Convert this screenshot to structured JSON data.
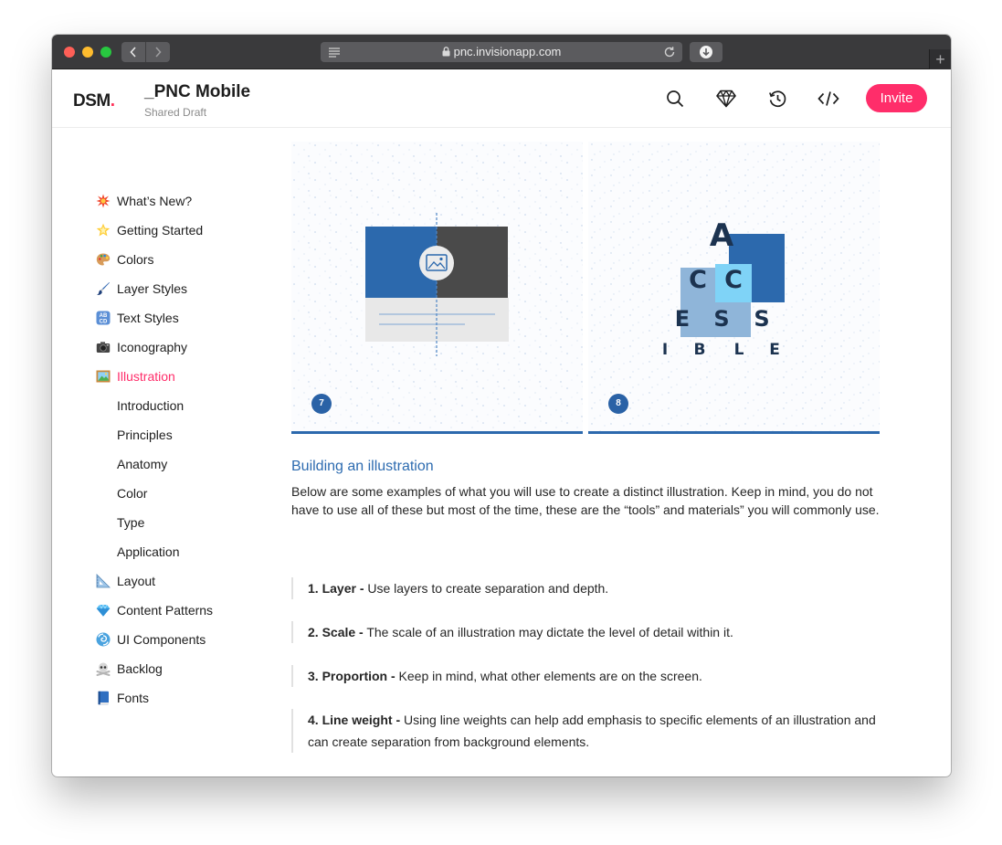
{
  "browser": {
    "url": "pnc.invisionapp.com"
  },
  "header": {
    "logo": "DSM",
    "logo_dot": ".",
    "project_title": "_PNC Mobile",
    "project_subtitle": "Shared Draft",
    "icons": [
      "search-icon",
      "sketch-diamond-icon",
      "history-icon",
      "code-icon"
    ],
    "invite_label": "Invite"
  },
  "sidebar": {
    "items": [
      {
        "icon": "collision-icon",
        "label": "What’s New?"
      },
      {
        "icon": "glowing-star-icon",
        "label": "Getting Started"
      },
      {
        "icon": "palette-icon",
        "label": "Colors"
      },
      {
        "icon": "paintbrush-icon",
        "label": "Layer Styles"
      },
      {
        "icon": "abcd-icon",
        "label": "Text Styles"
      },
      {
        "icon": "camera-icon",
        "label": "Iconography"
      },
      {
        "icon": "framed-picture-icon",
        "label": "Illustration",
        "active": true
      },
      {
        "icon": "triangular-ruler-icon",
        "label": "Layout"
      },
      {
        "icon": "gem-icon",
        "label": "Content Patterns"
      },
      {
        "icon": "cyclone-icon",
        "label": "UI Components"
      },
      {
        "icon": "skull-crossbones-icon",
        "label": "Backlog"
      },
      {
        "icon": "blue-book-icon",
        "label": "Fonts"
      }
    ],
    "subitems": [
      "Introduction",
      "Principles",
      "Anatomy",
      "Color",
      "Type",
      "Application"
    ],
    "active_color": "#ff2d6a"
  },
  "illustrations": [
    {
      "number": "7",
      "type": "image-card"
    },
    {
      "number": "8",
      "type": "accessible-letters",
      "letters": [
        "A",
        "C",
        "C",
        "E",
        "S",
        "S",
        "I",
        "B",
        "L",
        "E"
      ]
    }
  ],
  "content": {
    "title": "Building an illustration",
    "intro": "Below are some examples of what you will use to create a distinct illustration. Keep in mind, you do not have to use all of these but most of the time, these are the “tools” and materials” you will commonly use.",
    "rules": [
      {
        "label": "1. Layer -",
        "text": " Use layers to create separation and depth."
      },
      {
        "label": "2. Scale -",
        "text": " The scale of an illustration may dictate the level of detail within it."
      },
      {
        "label": "3. Proportion -",
        "text": " Keep in mind, what other elements are on the screen."
      },
      {
        "label": "4. Line weight -",
        "text": " Using line weights can help add emphasis to specific elements of an illustration and can create separation from background elements."
      }
    ]
  },
  "colors": {
    "accent": "#ff2d6a",
    "brand_blue": "#2c69ad",
    "navy": "#1c3350"
  }
}
